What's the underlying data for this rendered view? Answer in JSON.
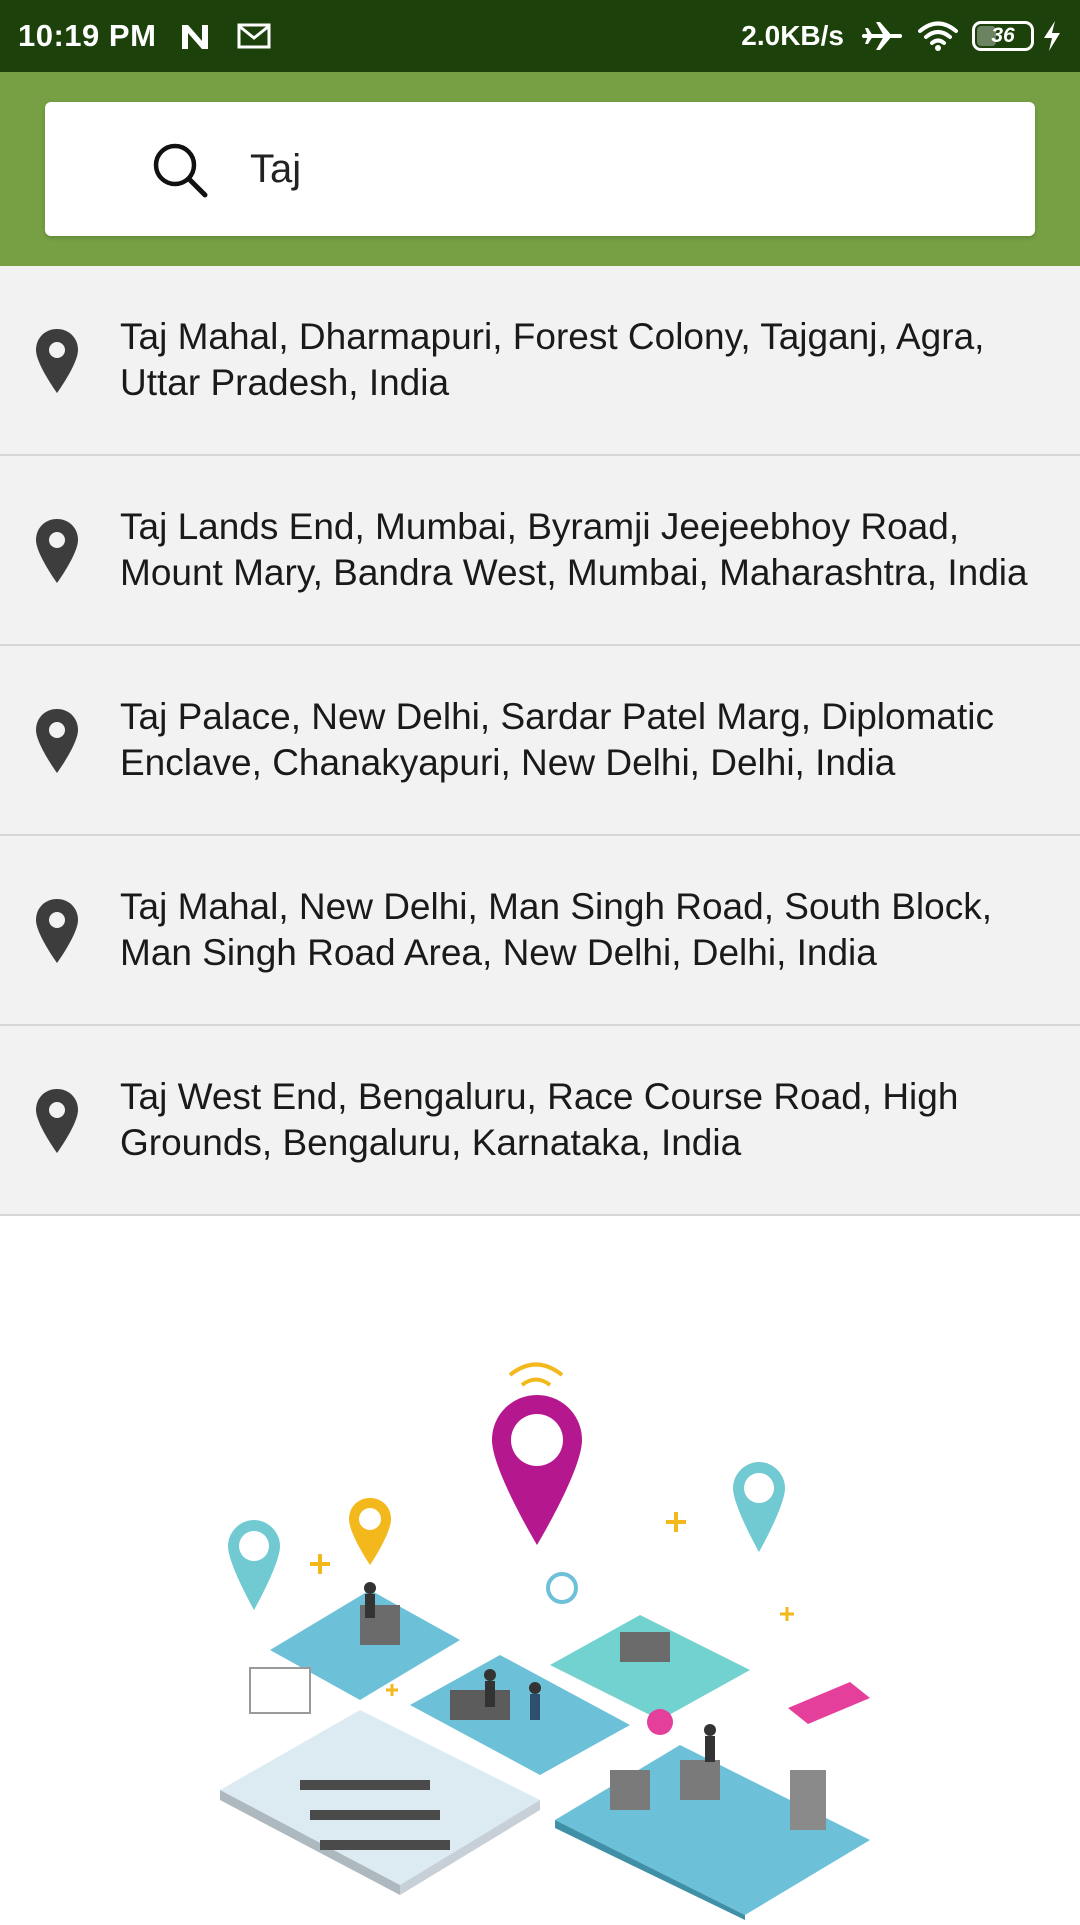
{
  "status_bar": {
    "time": "10:19 PM",
    "network_speed": "2.0KB/s",
    "battery_level": "36",
    "icons": [
      "n-icon",
      "mail-icon",
      "airplane-icon",
      "wifi-icon",
      "battery-icon",
      "charging-icon"
    ]
  },
  "search": {
    "query": "Taj",
    "icon": "search-icon"
  },
  "results": [
    {
      "icon": "map-pin-icon",
      "text": "Taj Mahal, Dharmapuri, Forest Colony, Tajganj, Agra, Uttar Pradesh, India"
    },
    {
      "icon": "map-pin-icon",
      "text": "Taj Lands End, Mumbai, Byramji Jeejeebhoy Road, Mount Mary, Bandra West, Mumbai, Maharashtra, India"
    },
    {
      "icon": "map-pin-icon",
      "text": "Taj Palace, New Delhi, Sardar Patel Marg, Diplomatic Enclave, Chanakyapuri, New Delhi, Delhi, India"
    },
    {
      "icon": "map-pin-icon",
      "text": "Taj Mahal, New Delhi, Man Singh Road, South Block, Man Singh Road Area, New Delhi, Delhi, India"
    },
    {
      "icon": "map-pin-icon",
      "text": "Taj West End, Bengaluru, Race Course Road, High Grounds, Bengaluru, Karnataka, India"
    }
  ],
  "colors": {
    "status_bar": "#1c410b",
    "header": "#76a043",
    "list_background": "#f2f2f2",
    "pin": "#3d3d3d",
    "illustration_magenta": "#b5178e",
    "illustration_teal": "#71cad2",
    "illustration_yellow": "#f2b81c",
    "illustration_blue": "#6cc1d8"
  }
}
